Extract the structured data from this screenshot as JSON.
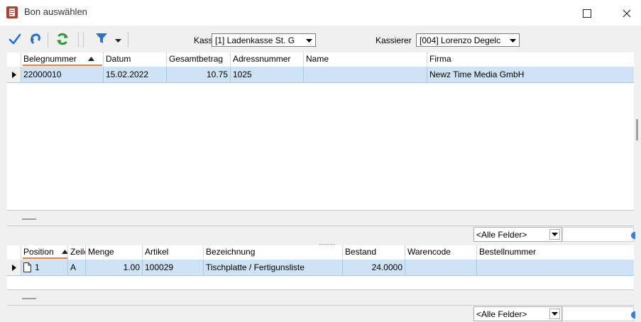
{
  "window": {
    "title": "Bon auswählen"
  },
  "toolbar": {
    "kasse_label": "Kasse",
    "kasse_value": "[1] Ladenkasse St. G",
    "kassierer_label": "Kassierer",
    "kassierer_value": "[004] Lorenzo Degelc"
  },
  "receipts": {
    "columns": [
      "Belegnummer",
      "Datum",
      "Gesamtbetrag",
      "Adressnummer",
      "Name",
      "Firma"
    ],
    "rows": [
      {
        "belegnummer": "22000010",
        "datum": "15.02.2022",
        "gesamtbetrag": "10.75",
        "adressnummer": "1025",
        "name": "",
        "firma": "Newz Time Media GmbH"
      }
    ]
  },
  "positions": {
    "columns": [
      "Position",
      "Zeile",
      "Menge",
      "Artikel",
      "Bezeichnung",
      "Bestand",
      "Warencode",
      "Bestellnummer"
    ],
    "rows": [
      {
        "position": "1",
        "zeile": "A",
        "menge": "1.00",
        "artikel": "100029",
        "bezeichnung": "Tischplatte / Fertigunsliste",
        "bestand": "24.0000",
        "warencode": "",
        "bestellnummer": ""
      }
    ]
  },
  "filter": {
    "all_fields_label": "<Alle Felder>"
  },
  "colors": {
    "selection": "#cfe3f7",
    "sort_underline": "#e8803a",
    "accept": "#1e6fd8",
    "refresh": "#2e9a2e"
  }
}
